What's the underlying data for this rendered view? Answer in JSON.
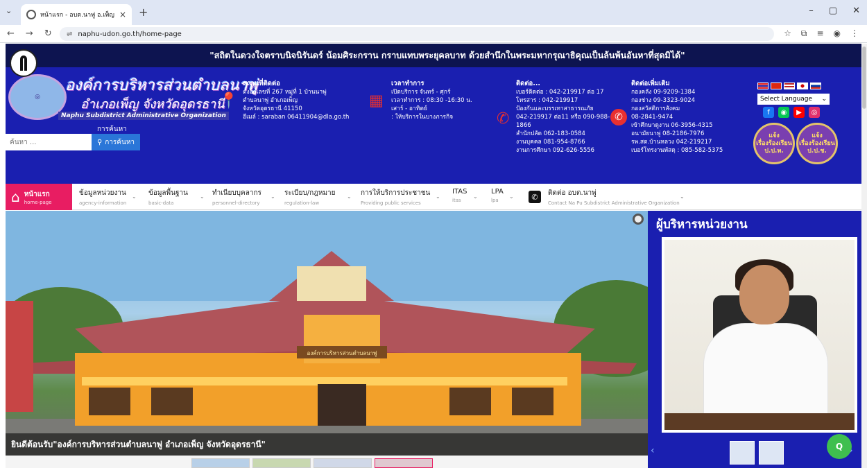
{
  "browser": {
    "tab_title": "หน้าแรก - อบต.นาพู่ อ.เพ็ญ จ.อุดร",
    "tab_close": "×",
    "new_tab": "+",
    "url": "naphu-udon.go.th/home-page",
    "window_controls": [
      "–",
      "▢",
      "✕"
    ]
  },
  "site": {
    "slogan": "\"สถิตในดวงใจตราบนิจนิรันดร์ น้อมศิระกราน กราบแทบพระยุคลบาท ด้วยสำนึกในพระมหากรุณาธิคุณเป็นล้นพ้นอันหาที่สุดมิได้\"",
    "org_name_th": "องค์การบริหารส่วนตำบลนาพู่",
    "org_location_th": "อำเภอเพ็ญ จังหวัดอุดรธานี",
    "org_name_en": "Naphu Subdistrict Administrative Organization",
    "search_label": "การค้นหา",
    "search_placeholder": "ค้นหา ...",
    "search_button": "การค้นหา",
    "address": {
      "heading": "สถานที่ติดต่อ",
      "lines": [
        "ตั้งอยู่เลขที่ 267 หมู่ที่ 1 บ้านนาพู่",
        "ตำบลนาพู่ อำเภอเพ็ญ",
        "จังหวัดอุดรธานี 41150",
        "อีเมล์ : saraban 06411904@dla.go.th"
      ]
    },
    "hours": {
      "heading": "เวลาทำการ",
      "lines": [
        "เปิดบริการ จันทร์ - ศุกร์",
        "เวลาทำการ : 08:30 -16:30 น.",
        "เสาร์ - อาทิตย์",
        ": ให้บริการในบางภารกิจ"
      ]
    },
    "contact": {
      "heading": "ติดต่อ...",
      "lines": [
        "เบอร์ติดต่อ : 042-219917 ต่อ 17",
        "โทรสาร : 042-219917",
        "ป้องกันและบรรเทาสาธารณภัย",
        "042-219917 ต่อ11 หรือ 090-988-",
        "1866",
        "สำนักปลัด 062-183-0584",
        "งานบุคคล 081-954-8766",
        "งานการศึกษา 092-626-5556"
      ]
    },
    "more_contact": {
      "heading": "ติดต่อเพิ่มเติม",
      "lines": [
        "กองคลัง 09-9209-1384",
        "กองช่าง 09-3323-9024",
        "กองสวัสดิการสังคม",
        "08-2841-9474",
        "เข้าศึกษาดูงาน 06-3956-4315",
        "อนามัยนาพู่ 08-2186-7976",
        "รพ.สต.บ้านหลวง 042-219217",
        "เบอร์โทรงานพัสดุ : 085-582-5375"
      ]
    },
    "language_select": "Select Language",
    "badges": [
      "แจ้ง\nเรื่องร้องเรียน\nป.ป.ท.",
      "แจ้ง\nเรื่องร้องเรียน\nป.ป.ช."
    ],
    "nav": [
      {
        "label": "หน้าแรก",
        "sub": "home-page"
      },
      {
        "label": "ข้อมูลหน่วยงาน",
        "sub": "agency-information"
      },
      {
        "label": "ข้อมูลพื้นฐาน",
        "sub": "basic-data"
      },
      {
        "label": "ทำเนียบบุคลากร",
        "sub": "personnel-directory"
      },
      {
        "label": "ระเบียบ/กฎหมาย",
        "sub": "regulation-law"
      },
      {
        "label": "การให้บริการประชาชน",
        "sub": "Providing public services"
      },
      {
        "label": "ITAS",
        "sub": "itas"
      },
      {
        "label": "LPA",
        "sub": "lpa"
      },
      {
        "label": "ติดต่อ อบต.นาพู่",
        "sub": "Contact Na Pu Subdistrict Administrative Organization"
      }
    ],
    "hero_caption": "ยินดีต้อนรับ\"องค์การบริหารส่วนตำบลนาพู่ อำเภอเพ็ญ จังหวัดอุดรธานี\"",
    "building_sign": "องค์การบริหารส่วนตำบลนาพู่",
    "side_title": "ผู้บริหารหน่วยงาน"
  },
  "colors": {
    "header_blue": "#1a1fb0",
    "slogan_bar": "#0d1450",
    "home_pink": "#e81d62",
    "search_btn": "#2a76d8"
  }
}
